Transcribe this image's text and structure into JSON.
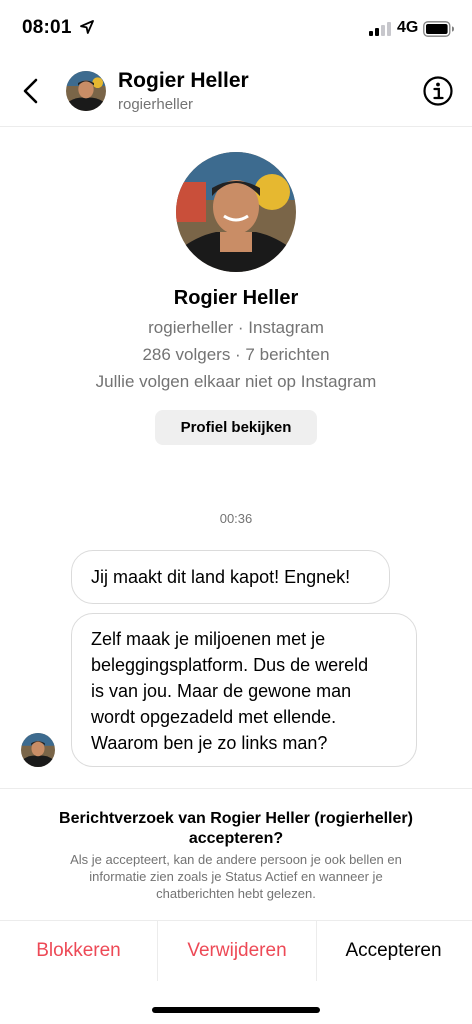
{
  "status_bar": {
    "time": "08:01",
    "network": "4G"
  },
  "header": {
    "name": "Rogier Heller",
    "handle": "rogierheller"
  },
  "profile": {
    "name": "Rogier Heller",
    "handle_line": "rogierheller · Instagram",
    "stats_line": "286 volgers · 7 berichten",
    "follow_line": "Jullie volgen elkaar niet op Instagram",
    "view_profile_label": "Profiel bekijken"
  },
  "conversation": {
    "timestamp": "00:36",
    "messages": [
      {
        "text": "Jij maakt dit land kapot! Engnek!"
      },
      {
        "lines": [
          "Zelf maak je miljoenen met je",
          "beleggingsplatform. Dus de wereld",
          "is van jou. Maar de gewone man",
          "wordt opgezadeld met ellende.",
          "Waarom ben je zo links man?"
        ]
      }
    ]
  },
  "request": {
    "title_line1": "Berichtverzoek van Rogier Heller (rogierheller)",
    "title_line2": "accepteren?",
    "desc_line1": "Als je accepteert, kan de andere persoon je ook bellen en",
    "desc_line2": "informatie zien zoals je Status Actief en wanneer je",
    "desc_line3": "chatberichten hebt gelezen."
  },
  "actions": {
    "block": "Blokkeren",
    "delete": "Verwijderen",
    "accept": "Accepteren"
  },
  "colors": {
    "destructive": "#ed4956",
    "secondary_text": "#737373",
    "bubble_border": "#dbdbdb"
  },
  "icons": [
    "location-arrow-icon",
    "signal-icon",
    "battery-icon",
    "back-chevron-icon",
    "info-icon"
  ]
}
